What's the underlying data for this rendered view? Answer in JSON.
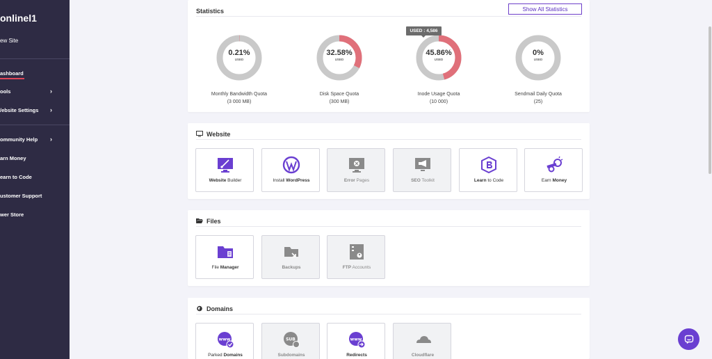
{
  "sidebar": {
    "title": "onlinel1",
    "subtitle": "ew Site",
    "items": [
      {
        "label": "ashboard",
        "chevron": false
      },
      {
        "label": "ools",
        "chevron": true
      },
      {
        "label": "/ebsite Settings",
        "chevron": true
      },
      {
        "label": "ommunity Help",
        "chevron": true
      },
      {
        "label": "arn Money",
        "chevron": false
      },
      {
        "label": "earn to Code",
        "chevron": false
      },
      {
        "label": "ustomer Support",
        "chevron": false
      },
      {
        "label": "wer Store",
        "chevron": false
      }
    ],
    "chevron_glyph": "›"
  },
  "statistics": {
    "title": "Statistics",
    "show_all_label": "Show All Statistics",
    "used_caption": "USED",
    "tooltip": "USED : 4,586",
    "colors": {
      "track": "#c9c9c9",
      "used": "#e0707a"
    },
    "items": [
      {
        "percent": "0.21%",
        "fraction": 0.0021,
        "label": "Monthly Bandwidth Quota",
        "sub": "(3 000 MB)"
      },
      {
        "percent": "32.58%",
        "fraction": 0.3258,
        "label": "Disk Space Quota",
        "sub": "(300 MB)"
      },
      {
        "percent": "45.86%",
        "fraction": 0.4586,
        "label": "Inode Usage Quota",
        "sub": "(10 000)"
      },
      {
        "percent": "0%",
        "fraction": 0,
        "label": "Sendmail Daily Quota",
        "sub": "(25)"
      }
    ]
  },
  "website": {
    "title": "Website",
    "tiles": [
      {
        "bold": "Website",
        "rest": " Builder",
        "bold_first": true,
        "disabled": false,
        "icon": "paintbrush-monitor-icon"
      },
      {
        "bold": "WordPress",
        "rest": "Install ",
        "bold_first": false,
        "disabled": false,
        "icon": "wordpress-icon"
      },
      {
        "bold": "Error",
        "rest": " Pages",
        "bold_first": true,
        "disabled": true,
        "icon": "error-monitor-icon"
      },
      {
        "bold": "SEO",
        "rest": " Toolkit",
        "bold_first": true,
        "disabled": true,
        "icon": "megaphone-icon"
      },
      {
        "bold": "Learn",
        "rest": " to Code",
        "bold_first": true,
        "disabled": false,
        "icon": "bootstrap-icon"
      },
      {
        "bold": "Money",
        "rest": "Earn ",
        "bold_first": false,
        "disabled": false,
        "icon": "cannon-icon"
      }
    ]
  },
  "files": {
    "title": "Files",
    "tiles": [
      {
        "bold": "Manager",
        "rest": "File ",
        "bold_first": false,
        "disabled": false,
        "icon": "folder-icon"
      },
      {
        "bold": "Backups",
        "rest": "",
        "bold_first": true,
        "disabled": true,
        "icon": "backup-box-icon"
      },
      {
        "bold": "FTP",
        "rest": " Accounts",
        "bold_first": true,
        "disabled": true,
        "icon": "ftp-server-icon"
      }
    ]
  },
  "domains": {
    "title": "Domains",
    "tiles": [
      {
        "bold": "Domains",
        "rest": "Parked ",
        "bold_first": false,
        "disabled": false,
        "icon": "www-check-icon"
      },
      {
        "bold": "Subdomains",
        "rest": "",
        "bold_first": true,
        "disabled": true,
        "icon": "subdomain-icon"
      },
      {
        "bold": "Redirects",
        "rest": "",
        "bold_first": true,
        "disabled": false,
        "icon": "www-redirect-icon"
      },
      {
        "bold": "Cloudflare",
        "rest": "",
        "bold_first": true,
        "disabled": true,
        "icon": "cloud-icon"
      }
    ]
  },
  "accent": "#6a3fd1"
}
